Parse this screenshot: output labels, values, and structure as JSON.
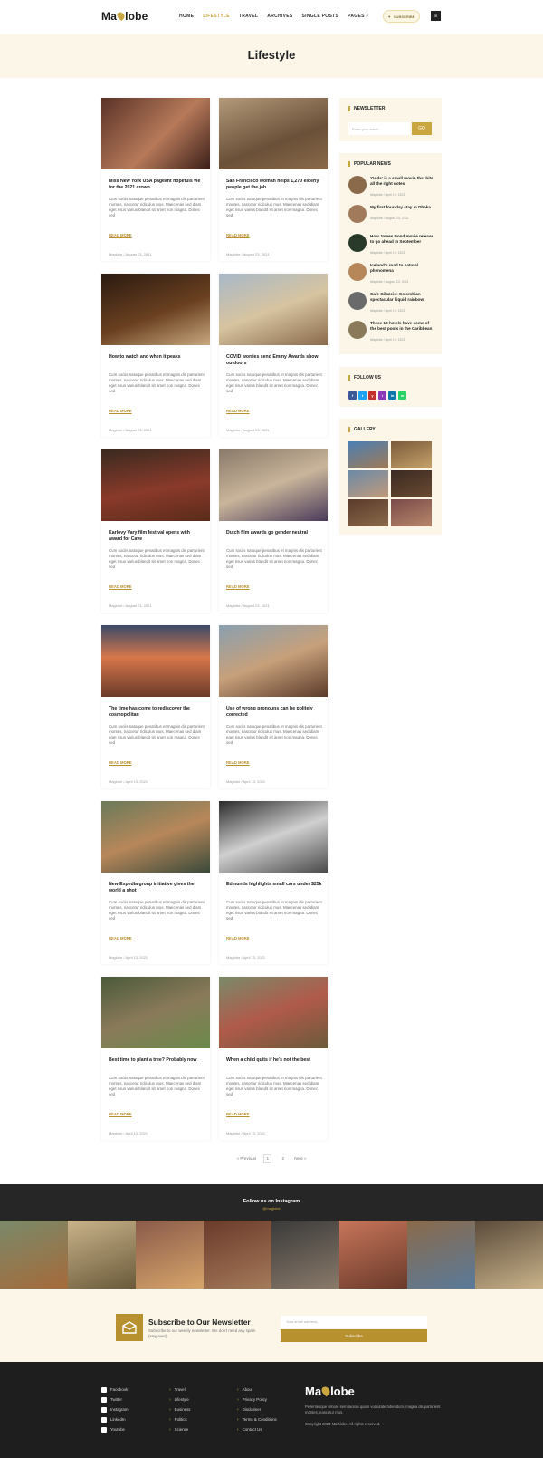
{
  "header": {
    "logo_left": "Ma",
    "logo_right": "lobe",
    "nav": [
      "HOME",
      "LIFESTYLE",
      "TRAVEL",
      "ARCHIVES",
      "SINGLE POSTS",
      "PAGES"
    ],
    "subscribe": "SUBSCRIBE"
  },
  "page_title": "Lifestyle",
  "posts": [
    {
      "title": "Miss New York USA pageant hopefuls vie for the 2021 crown",
      "excerpt": "Cum sociis natoque penatibus et magnis dis parturient montes, nascetur ridiculus mus. Maecenas sed diam eget risus varius blandit sit amet non magna. Donec sed",
      "more": "READ MORE",
      "meta": "Maglobe  /  August 23, 2021"
    },
    {
      "title": "San Francisco woman helps 1,270 elderly people get the jab",
      "excerpt": "Cum sociis natoque penatibus et magnis dis parturient montes, nascetur ridiculus mus. Maecenas sed diam eget risus varius blandit sit amet non magna. Donec sed",
      "more": "READ MORE",
      "meta": "Maglobe  /  August 23, 2021"
    },
    {
      "title": "How to watch and when it peaks",
      "excerpt": "Cum sociis natoque penatibus et magnis dis parturient montes, nascetur ridiculus mus. Maecenas sed diam eget risus varius blandit sit amet non magna. Donec sed",
      "more": "READ MORE",
      "meta": "Maglobe  /  August 23, 2021"
    },
    {
      "title": "COVID worries send Emmy Awards show outdoors",
      "excerpt": "Cum sociis natoque penatibus et magnis dis parturient montes, nascetur ridiculus mus. Maecenas sed diam eget risus varius blandit sit amet non magna. Donec sed",
      "more": "READ MORE",
      "meta": "Maglobe  /  August 23, 2021"
    },
    {
      "title": "Karlovy Vary film festival opens with award for Cave",
      "excerpt": "Cum sociis natoque penatibus et magnis dis parturient montes, nascetur ridiculus mus. Maecenas sed diam eget risus varius blandit sit amet non magna. Donec sed",
      "more": "READ MORE",
      "meta": "Maglobe  /  August 23, 2021"
    },
    {
      "title": "Dutch film awards go gender neutral",
      "excerpt": "Cum sociis natoque penatibus et magnis dis parturient montes, nascetur ridiculus mus. Maecenas sed diam eget risus varius blandit sit amet non magna. Donec sed",
      "more": "READ MORE",
      "meta": "Maglobe  /  August 23, 2021"
    },
    {
      "title": "The time has come to rediscover the cosmopolitan",
      "excerpt": "Cum sociis natoque penatibus et magnis dis parturient montes, nascetur ridiculus mus. Maecenas sed diam eget risus varius blandit sit amet non magna. Donec sed",
      "more": "READ MORE",
      "meta": "Maglobe  /  April 13, 2021"
    },
    {
      "title": "Use of wrong pronouns can be politely corrected",
      "excerpt": "Cum sociis natoque penatibus et magnis dis parturient montes, nascetur ridiculus mus. Maecenas sed diam eget risus varius blandit sit amet non magna. Donec sed",
      "more": "READ MORE",
      "meta": "Maglobe  /  April 13, 2021"
    },
    {
      "title": "New Expedia group initiative gives the world a shot",
      "excerpt": "Cum sociis natoque penatibus et magnis dis parturient montes, nascetur ridiculus mus. Maecenas sed diam eget risus varius blandit sit amet non magna. Donec sed",
      "more": "READ MORE",
      "meta": "Maglobe  /  April 13, 2021"
    },
    {
      "title": "Edmunds highlights small cars under $25k",
      "excerpt": "Cum sociis natoque penatibus et magnis dis parturient montes, nascetur ridiculus mus. Maecenas sed diam eget risus varius blandit sit amet non magna. Donec sed",
      "more": "READ MORE",
      "meta": "Maglobe  /  April 13, 2021"
    },
    {
      "title": "Best time to plant a tree? Probably now",
      "excerpt": "Cum sociis natoque penatibus et magnis dis parturient montes, nascetur ridiculus mus. Maecenas sed diam eget risus varius blandit sit amet non magna. Donec sed",
      "more": "READ MORE",
      "meta": "Maglobe  /  April 13, 2021"
    },
    {
      "title": "When a child quits if he's not the best",
      "excerpt": "Cum sociis natoque penatibus et magnis dis parturient montes, nascetur ridiculus mus. Maecenas sed diam eget risus varius blandit sit amet non magna. Donec sed",
      "more": "READ MORE",
      "meta": "Maglobe  /  April 13, 2021"
    }
  ],
  "sidebar": {
    "newsletter_title": "NEWSLETTER",
    "newsletter_placeholder": "Enter your email...",
    "newsletter_go": "GO",
    "popular_title": "POPULAR NEWS",
    "popular": [
      {
        "title": "'Gods' is a small movie that hits all the right notes",
        "meta": "Maglobe / April 19, 2021"
      },
      {
        "title": "My first four-day stay in Dhaka",
        "meta": "Maglobe / August 23, 2021"
      },
      {
        "title": "How James Bond movie release to go ahead in September",
        "meta": "Maglobe / April 19, 2021"
      },
      {
        "title": "Iceland's road to natural phenomena",
        "meta": "Maglobe / August 23, 2021"
      },
      {
        "title": "Cafe Gilozeio: Colombian spectacular 'liquid rainbow'",
        "meta": "Maglobe / April 19, 2021"
      },
      {
        "title": "These 10 hotels have some of the best pools in the Caribbean",
        "meta": "Maglobe / April 19, 2021"
      }
    ],
    "follow_title": "FOLLOW US",
    "social": [
      "f",
      "t",
      "y",
      "i",
      "in",
      "w"
    ],
    "gallery_title": "GALLERY"
  },
  "pagination": {
    "prev": "« Previous",
    "pages": [
      "1",
      "2"
    ],
    "next": "Next »"
  },
  "instagram": {
    "title": "Follow us on Instagram",
    "handle": "@maglobe"
  },
  "newsletter_bottom": {
    "title": "Subscribe to Our Newsletter",
    "text": "Subscribe to our weekly newsletter. We don't need any spam (Hey ever)",
    "placeholder": "Your email address...",
    "button": "Subscribe"
  },
  "footer": {
    "col1": [
      "Facebook",
      "Twitter",
      "Instagram",
      "LinkedIn",
      "Youtube"
    ],
    "col2": [
      "Travel",
      "Lifestyle",
      "Business",
      "Politics",
      "Science"
    ],
    "col3": [
      "About",
      "Privacy Policy",
      "Disclaimer",
      "Terms & Conditions",
      "Contact Us"
    ],
    "logo_left": "Ma",
    "logo_right": "lobe",
    "desc": "Pellentesque ornare sem lacinia quam vulputate bibendum, magna dis parturient montes, nascetur mus.",
    "copyright": "Copyright 2023 MaGlobe. All rights reserved."
  },
  "colors": {
    "accent": "#c9a640",
    "cream": "#fbf6e8",
    "dark": "#262626"
  }
}
